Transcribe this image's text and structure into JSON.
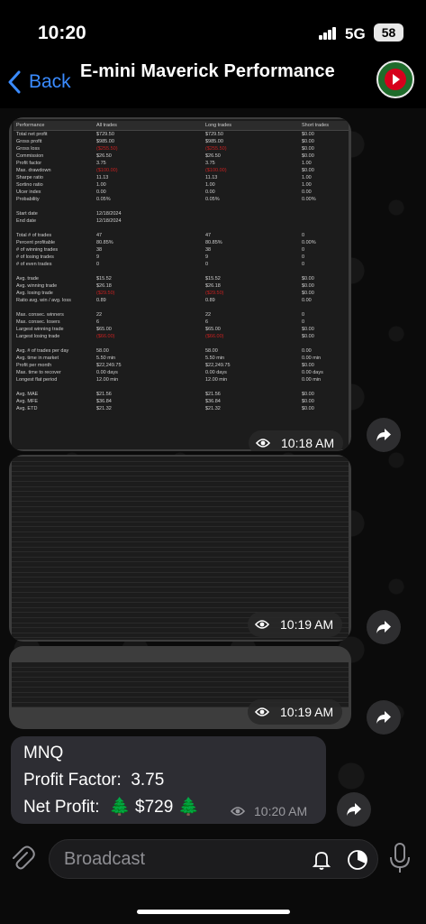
{
  "status": {
    "time": "10:20",
    "network": "5G",
    "battery": "58"
  },
  "nav": {
    "back_label": "Back",
    "title": "E-mini Maverick Performance"
  },
  "messages": {
    "perf_screenshot": {
      "time": "10:18 AM",
      "table": {
        "headers": [
          "Performance",
          "All trades",
          "Long trades",
          "Short trades"
        ],
        "rows": [
          [
            "Total net profit",
            "$729.50",
            "$729.50",
            "$0.00"
          ],
          [
            "Gross profit",
            "$985.00",
            "$985.00",
            "$0.00"
          ],
          [
            "Gross loss",
            "($255.50)",
            "($255.50)",
            "$0.00"
          ],
          [
            "Commission",
            "$26.50",
            "$26.50",
            "$0.00"
          ],
          [
            "Profit factor",
            "3.75",
            "3.75",
            "1.00"
          ],
          [
            "Max. drawdown",
            "($100.00)",
            "($100.00)",
            "$0.00"
          ],
          [
            "Sharpe ratio",
            "11.13",
            "11.13",
            "1.00"
          ],
          [
            "Sortino ratio",
            "1.00",
            "1.00",
            "1.00"
          ],
          [
            "Ulcer index",
            "0.00",
            "0.00",
            "0.00"
          ],
          [
            "Probability",
            "0.05%",
            "0.05%",
            "0.00%"
          ],
          null,
          [
            "Start date",
            "12/18/2024",
            "",
            ""
          ],
          [
            "End date",
            "12/18/2024",
            "",
            ""
          ],
          null,
          [
            "Total # of trades",
            "47",
            "47",
            "0"
          ],
          [
            "Percent profitable",
            "80.85%",
            "80.85%",
            "0.00%"
          ],
          [
            "# of winning trades",
            "38",
            "38",
            "0"
          ],
          [
            "# of losing trades",
            "9",
            "9",
            "0"
          ],
          [
            "# of even trades",
            "0",
            "0",
            "0"
          ],
          null,
          [
            "Avg. trade",
            "$15.52",
            "$15.52",
            "$0.00"
          ],
          [
            "Avg. winning trade",
            "$26.18",
            "$26.18",
            "$0.00"
          ],
          [
            "Avg. losing trade",
            "($29.50)",
            "($29.50)",
            "$0.00"
          ],
          [
            "Ratio avg. win / avg. loss",
            "0.89",
            "0.89",
            "0.00"
          ],
          null,
          [
            "Max. consec. winners",
            "22",
            "22",
            "0"
          ],
          [
            "Max. consec. losers",
            "6",
            "6",
            "0"
          ],
          [
            "Largest winning trade",
            "$65.00",
            "$65.00",
            "$0.00"
          ],
          [
            "Largest losing trade",
            "($66.00)",
            "($66.00)",
            "$0.00"
          ],
          null,
          [
            "Avg. # of trades per day",
            "58.00",
            "58.00",
            "0.00"
          ],
          [
            "Avg. time in market",
            "5.50 min",
            "5.50 min",
            "0.00 min"
          ],
          [
            "Profit per month",
            "$22,249.75",
            "$22,249.75",
            "$0.00"
          ],
          [
            "Max. time to recover",
            "0.00 days",
            "0.00 days",
            "0.00 days"
          ],
          [
            "Longest flat period",
            "12.00 min",
            "12.00 min",
            "0.00 min"
          ],
          null,
          [
            "Avg. MAE",
            "$21.56",
            "$21.56",
            "$0.00"
          ],
          [
            "Avg. MFE",
            "$36.84",
            "$36.84",
            "$0.00"
          ],
          [
            "Avg. ETD",
            "$21.32",
            "$21.32",
            "$0.00"
          ]
        ]
      }
    },
    "trades_screenshot_1": {
      "time": "10:19 AM"
    },
    "trades_screenshot_2": {
      "time": "10:19 AM"
    },
    "text_message": {
      "line1": "MNQ",
      "line2_label": "Profit Factor:",
      "line2_value": "3.75",
      "line3_label": "Net Profit:",
      "line3_tree": "🌲",
      "line3_value": "$729",
      "time": "10:20 AM"
    }
  },
  "input": {
    "placeholder": "Broadcast"
  },
  "colors": {
    "accent": "#3a8bff",
    "negative": "#c62020",
    "tree": "#2bb84a"
  }
}
